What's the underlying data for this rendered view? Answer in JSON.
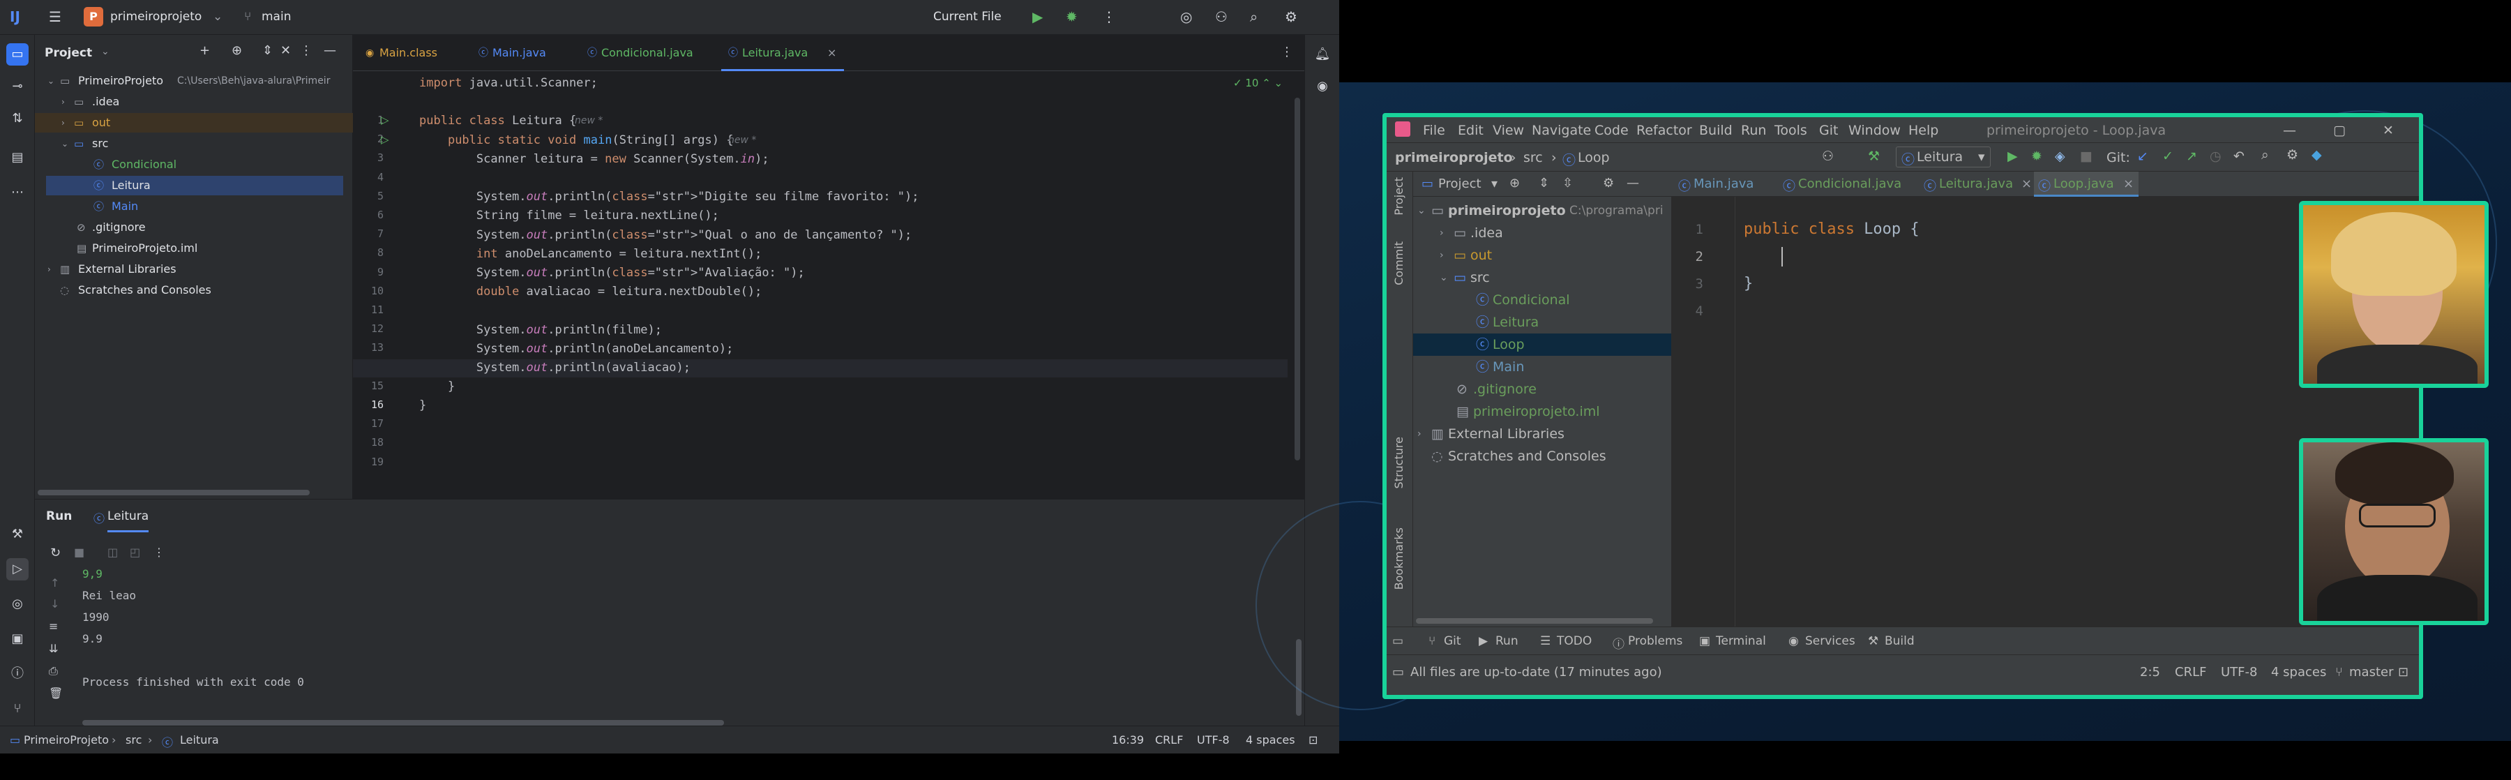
{
  "ide": {
    "project_name": "primeiroprojeto",
    "project_badge": "P",
    "branch": "main",
    "run_config": "Current File",
    "project_panel": {
      "title": "Project",
      "root_name": "PrimeiroProjeto",
      "root_path": "C:\\Users\\Beh\\java-alura\\Primeir",
      "items": [
        {
          "label": ".idea",
          "type": "folder"
        },
        {
          "label": "out",
          "type": "folder"
        },
        {
          "label": "src",
          "type": "folder"
        },
        {
          "label": "Condicional",
          "type": "class"
        },
        {
          "label": "Leitura",
          "type": "class"
        },
        {
          "label": "Main",
          "type": "class"
        },
        {
          "label": ".gitignore",
          "type": "file"
        },
        {
          "label": "PrimeiroProjeto.iml",
          "type": "file"
        },
        {
          "label": "External Libraries",
          "type": "lib"
        },
        {
          "label": "Scratches and Consoles",
          "type": "scratch"
        }
      ]
    },
    "tabs": [
      "Main.class",
      "Main.java",
      "Condicional.java",
      "Leitura.java"
    ],
    "active_tab": "Leitura.java",
    "inspection_count": "10",
    "code_lines": [
      "import java.util.Scanner;",
      "",
      "public class Leitura {",
      "    public static void main(String[] args) {",
      "        Scanner leitura = new Scanner(System.in);",
      "",
      "        System.out.println(\"Digite seu filme favorito: \");",
      "        String filme = leitura.nextLine();",
      "        System.out.println(\"Qual o ano de lançamento? \");",
      "        int anoDeLancamento = leitura.nextInt();",
      "        System.out.println(\"Avaliação: \");",
      "        double avaliacao = leitura.nextDouble();",
      "",
      "        System.out.println(filme);",
      "        System.out.println(anoDeLancamento);",
      "        System.out.println(avaliacao);",
      "    }",
      "}",
      ""
    ],
    "hint_new": "new *",
    "run_panel": {
      "title": "Run",
      "tab": "Leitura",
      "output": [
        "9,9",
        "Rei leao",
        "1990",
        "9.9",
        "",
        "Process finished with exit code 0"
      ]
    },
    "status": {
      "breadcrumb": [
        "PrimeiroProjeto",
        "src",
        "Leitura"
      ],
      "position": "16:39",
      "line_sep": "CRLF",
      "encoding": "UTF-8",
      "indent": "4 spaces"
    }
  },
  "video_ide": {
    "menu": [
      "File",
      "Edit",
      "View",
      "Navigate",
      "Code",
      "Refactor",
      "Build",
      "Run",
      "Tools",
      "Git",
      "Window",
      "Help"
    ],
    "window_title": "primeiroprojeto - Loop.java",
    "breadcrumb": [
      "primeiroprojeto",
      "src",
      "Loop"
    ],
    "run_config": "Leitura",
    "git_label": "Git:",
    "project_label": "Project",
    "tree": [
      {
        "label": "primeiroprojeto",
        "extra": "C:\\programa\\pri"
      },
      {
        "label": ".idea"
      },
      {
        "label": "out"
      },
      {
        "label": "src"
      },
      {
        "label": "Condicional"
      },
      {
        "label": "Leitura"
      },
      {
        "label": "Loop"
      },
      {
        "label": "Main"
      },
      {
        "label": ".gitignore"
      },
      {
        "label": "primeiroprojeto.iml"
      },
      {
        "label": "External Libraries"
      },
      {
        "label": "Scratches and Consoles"
      }
    ],
    "tabs": [
      "Main.java",
      "Condicional.java",
      "Leitura.java",
      "Loop.java"
    ],
    "code_lines": [
      "public class Loop {",
      "",
      "}",
      ""
    ],
    "side_labels": [
      "Project",
      "Commit",
      "Structure",
      "Bookmarks"
    ],
    "bottom_tools": [
      "Git",
      "Run",
      "TODO",
      "Problems",
      "Terminal",
      "Services",
      "Build"
    ],
    "status": {
      "message": "All files are up-to-date (17 minutes ago)",
      "position": "2:5",
      "line_sep": "CRLF",
      "encoding": "UTF-8",
      "indent": "4 spaces",
      "branch": "master"
    }
  },
  "colors": {
    "accent_green": "#19d39a",
    "accent_blue": "#548af7"
  }
}
